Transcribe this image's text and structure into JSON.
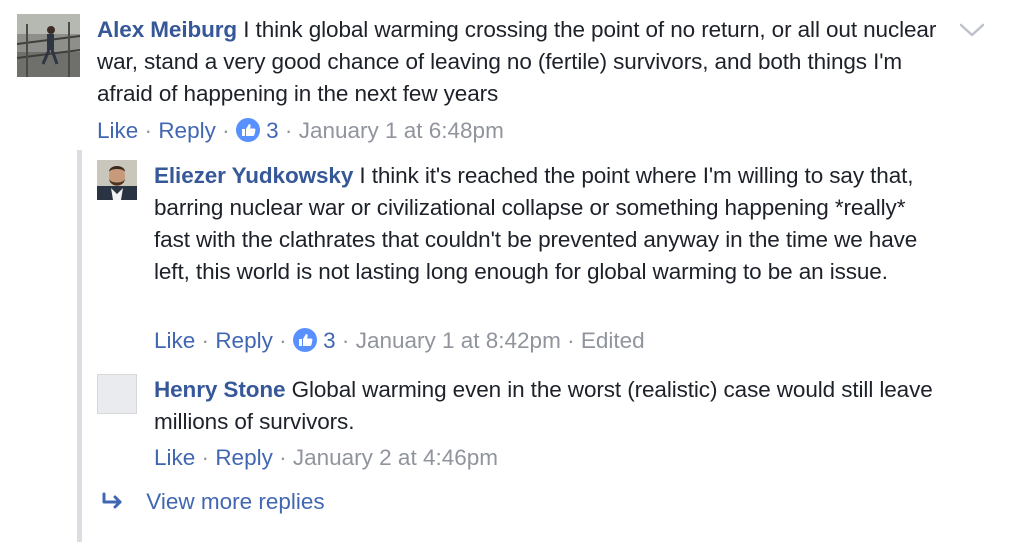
{
  "comments": [
    {
      "author": "Alex Meiburg",
      "text": "I think global warming crossing the point of no return, or all out nuclear war, stand a very good chance of leaving no (fertile) survivors, and both things I'm afraid of happening in the next few years",
      "like_label": "Like",
      "reply_label": "Reply",
      "sep": "·",
      "reactions": "3",
      "timestamp": "January 1 at 6:48pm",
      "edited": ""
    },
    {
      "author": "Eliezer Yudkowsky",
      "text": "I think it's reached the point where I'm willing to say that, barring nuclear war or civilizational collapse or something happening *really* fast with the clathrates that couldn't be prevented anyway in the time we have left, this world is not lasting long enough for global warming to be an issue.",
      "like_label": "Like",
      "reply_label": "Reply",
      "sep": "·",
      "reactions": "3",
      "timestamp": "January 1 at 8:42pm",
      "edited": "Edited"
    },
    {
      "author": "Henry Stone",
      "text": "Global warming even in the worst (realistic) case would still leave millions of survivors.",
      "like_label": "Like",
      "reply_label": "Reply",
      "sep": "·",
      "timestamp": "January 2 at 4:46pm"
    }
  ],
  "view_more_label": "View more replies",
  "icons": {
    "options": "chevron-down-icon",
    "like_reaction": "thumbs-up-icon",
    "view_more": "reply-arrow-icon"
  },
  "colors": {
    "author": "#365899",
    "link": "#4267b2",
    "meta": "#90949c",
    "text": "#1d2129",
    "like_badge": "#5890ff"
  }
}
